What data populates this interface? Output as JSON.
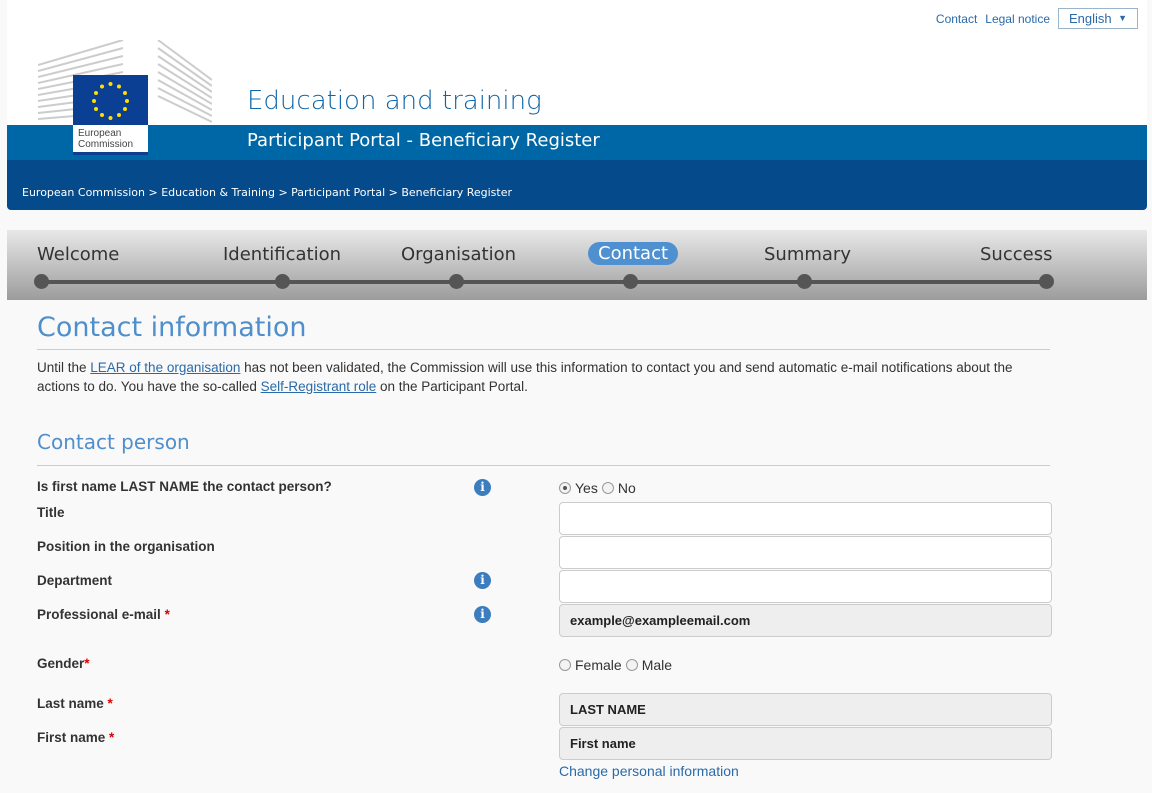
{
  "top_links": {
    "contact": "Contact",
    "legal": "Legal notice",
    "language": "English"
  },
  "logo": {
    "line1": "European",
    "line2": "Commission"
  },
  "header": {
    "title": "Education and training",
    "subtitle": "Participant Portal - Beneficiary Register"
  },
  "breadcrumb": "European Commission >  Education & Training >  Participant Portal >  Beneficiary Register",
  "steps": [
    "Welcome",
    "Identification",
    "Organisation",
    "Contact",
    "Summary",
    "Success"
  ],
  "active_step": "Contact",
  "page": {
    "title": "Contact information",
    "intro_1": "Until the ",
    "intro_link1": "LEAR of the organisation",
    "intro_2": " has not been validated, the Commission will use this information to contact you and send automatic e-mail notifications about the actions to do. You have the so-called ",
    "intro_link2": "Self-Registrant role",
    "intro_3": " on the Participant Portal."
  },
  "section": "Contact person",
  "form": {
    "q_contact": "Is first name LAST NAME the contact person?",
    "yes": "Yes",
    "no": "No",
    "title": "Title",
    "position": "Position in the organisation",
    "department": "Department",
    "email": "Professional e-mail",
    "email_value": "example@exampleemail.com",
    "gender": "Gender",
    "female": "Female",
    "male": "Male",
    "last_name": "Last name",
    "last_name_value": "LAST NAME",
    "first_name": "First name",
    "first_name_value": "First name",
    "required": "*",
    "change_link": "Change personal information"
  }
}
